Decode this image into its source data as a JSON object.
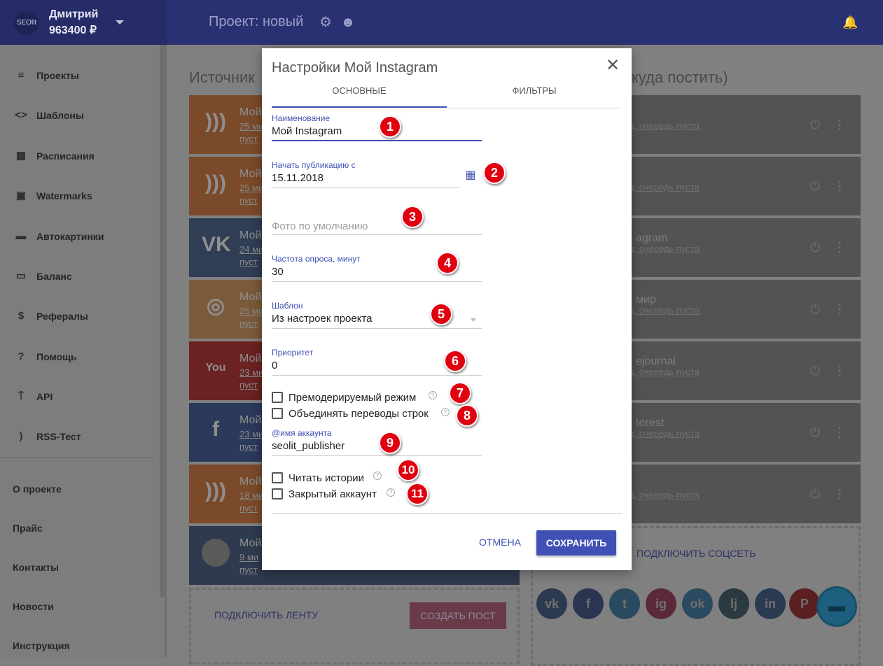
{
  "header": {
    "logo": "SEOlit",
    "user_name": "Дмитрий",
    "balance": "963400 ₽",
    "project_title": "Проект: новый"
  },
  "sidebar": {
    "items": [
      {
        "label": "Проекты",
        "icon": "≡"
      },
      {
        "label": "Шаблоны",
        "icon": "<>"
      },
      {
        "label": "Расписания",
        "icon": "▦"
      },
      {
        "label": "Watermarks",
        "icon": "▣"
      },
      {
        "label": "Автокартинки",
        "icon": "▬"
      },
      {
        "label": "Баланс",
        "icon": "▭"
      },
      {
        "label": "Рефералы",
        "icon": "$"
      },
      {
        "label": "Помощь",
        "icon": "?"
      },
      {
        "label": "API",
        "icon": "⍑"
      },
      {
        "label": "RSS-Тест",
        "icon": ")"
      }
    ],
    "links": [
      "О проекте",
      "Прайс",
      "Контакты",
      "Новости",
      "Инструкция"
    ]
  },
  "background": {
    "left_heading": "Источник",
    "right_heading": "куда постить)",
    "sources": [
      {
        "name": "Мой",
        "time": "25 ми",
        "status": "пуст",
        "icon": "rss",
        "color": "#7a4a2a"
      },
      {
        "name": "Мой",
        "time": "25 ми",
        "status": "пуст",
        "icon": "rss",
        "color": "#7a4a2a"
      },
      {
        "name": "Мой",
        "time": "24 ми",
        "status": "пуст",
        "icon": "vk",
        "color": "#2f3d55"
      },
      {
        "name": "Мой",
        "time": "25 ми",
        "status": "пуст",
        "icon": "instagram",
        "color": "#7a5a3a"
      },
      {
        "name": "Мой",
        "time": "23 ми",
        "status": "пуст",
        "icon": "youtube",
        "color": "#6a2222"
      },
      {
        "name": "Мой",
        "time": "23 ми",
        "status": "пуст",
        "icon": "facebook",
        "color": "#2b3a5a"
      },
      {
        "name": "Мой",
        "time": "18 ми",
        "status": "пуст",
        "icon": "rss",
        "color": "#7a4a2a"
      },
      {
        "name": "Мой",
        "time": "9 ми",
        "status": "пуст",
        "icon": "avatar",
        "color": "#2e3a4e"
      }
    ],
    "targets": [
      {
        "name": "",
        "status": "д, очередь пуста"
      },
      {
        "name": "",
        "status": "д, очередь пуста"
      },
      {
        "name": "agram",
        "status": "д, очередь пуста"
      },
      {
        "name": "мир",
        "status": "д, очередь пуста"
      },
      {
        "name": "ejournal",
        "status": "д, очередь пуста"
      },
      {
        "name": "terest",
        "status": "д, очередь пуста"
      },
      {
        "name": "",
        "status": "д, очередь пуста"
      }
    ],
    "connect_feed": "ПОДКЛЮЧИТЬ ЛЕНТУ",
    "create_post": "СОЗДАТЬ ПОСТ",
    "connect_social": "ПОДКЛЮЧИТЬ СОЦСЕТЬ",
    "social_icons": [
      {
        "label": "vk",
        "color": "#2b3a50"
      },
      {
        "label": "f",
        "color": "#2a3550"
      },
      {
        "label": "t",
        "color": "#2a4a60"
      },
      {
        "label": "ig",
        "color": "#5a2a3a"
      },
      {
        "label": "ok",
        "color": "#2a4a60"
      },
      {
        "label": "lj",
        "color": "#2a3a40"
      },
      {
        "label": "in",
        "color": "#2a3a50"
      },
      {
        "label": "P",
        "color": "#5a2020"
      }
    ]
  },
  "modal": {
    "title": "Настройки Мой Instagram",
    "tab_main": "ОСНОВНЫЕ",
    "tab_filters": "ФИЛЬТРЫ",
    "name_label": "Наименование",
    "name_value": "Мой Instagram",
    "start_label": "Начать публикацию с",
    "start_value": "15.11.2018",
    "photo_placeholder": "Фото по умолчанию",
    "freq_label": "Частота опроса, минут",
    "freq_value": "30",
    "template_label": "Шаблон",
    "template_value": "Из настроек проекта",
    "priority_label": "Приоритет",
    "priority_value": "0",
    "premod_label": "Премодерируемый режим",
    "merge_label": "Объединять переводы строк",
    "account_label": "@имя аккаунта",
    "account_value": "seolit_publisher",
    "stories_label": "Читать истории",
    "private_label": "Закрытый аккаунт",
    "cancel": "ОТМЕНА",
    "save": "СОХРАНИТЬ"
  },
  "badges": [
    "1",
    "2",
    "3",
    "4",
    "5",
    "6",
    "7",
    "8",
    "9",
    "10",
    "11"
  ]
}
